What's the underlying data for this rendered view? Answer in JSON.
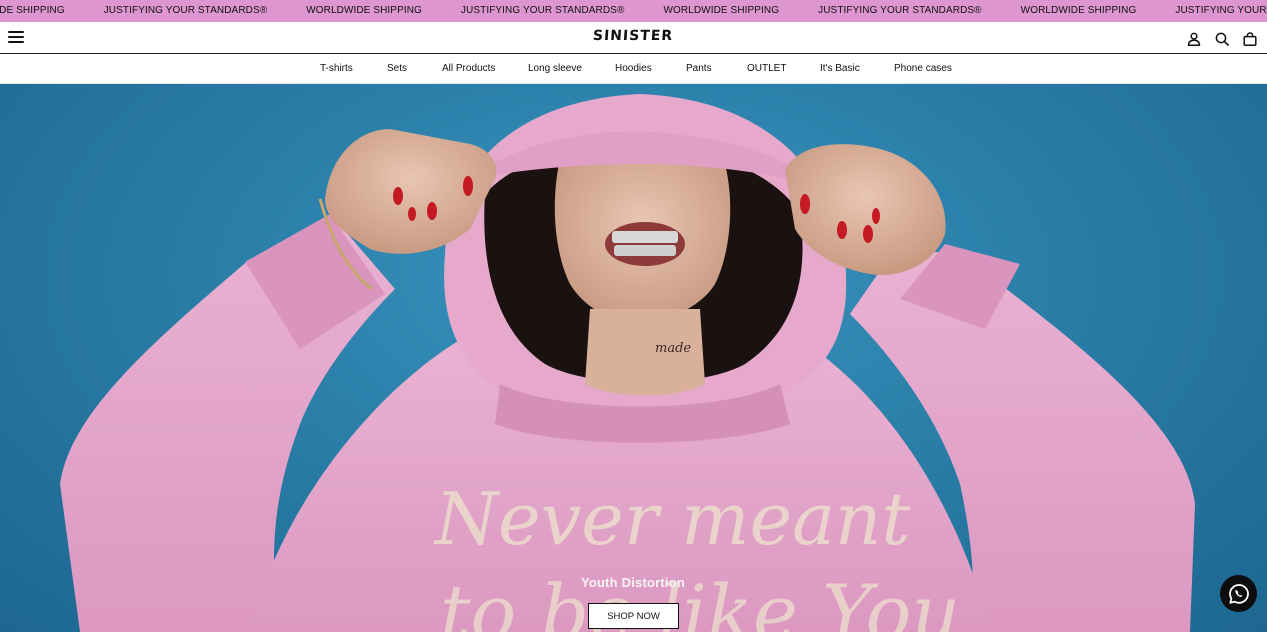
{
  "announcement": {
    "items": [
      "WORLDWIDE SHIPPING",
      "JUSTIFYING YOUR STANDARDS®",
      "WORLDWIDE SHIPPING",
      "JUSTIFYING YOUR STANDARDS®",
      "WORLDWIDE SHIPPING",
      "JUSTIFYING YOUR STANDARDS®",
      "WORLDWIDE SHIPPING",
      "JUSTIFYING YOUR STANDARDS®"
    ],
    "background": "#dd96cf"
  },
  "header": {
    "logo": "SINISTER",
    "icons": [
      "menu-icon",
      "account-icon",
      "search-icon",
      "bag-icon"
    ]
  },
  "nav": {
    "items": [
      "T-shirts",
      "Sets",
      "All Products",
      "Long sleeve",
      "Hoodies",
      "Pants",
      "OUTLET",
      "It's Basic",
      "Phone cases"
    ]
  },
  "hero": {
    "subtitle": "Youth Distortion",
    "button_label": "SHOP NOW",
    "print_line_1": "Never meant",
    "print_line_2": "to be like You",
    "neck_tattoo": "made"
  },
  "chat": {
    "icon": "whatsapp-icon"
  },
  "colors": {
    "announcement_bg": "#dd96cf",
    "hero_bg": "#2a7ea8",
    "hoodie": "#e2a2c8"
  }
}
